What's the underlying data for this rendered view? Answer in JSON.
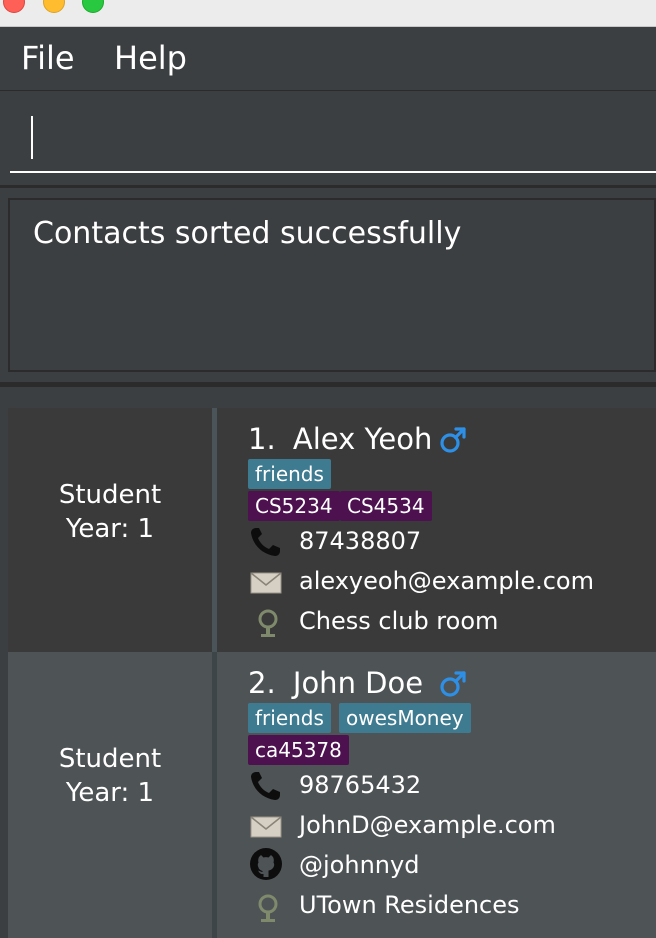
{
  "menu": {
    "file_label": "File",
    "help_label": "Help"
  },
  "command": {
    "value": ""
  },
  "result": {
    "message": "Contacts sorted successfully"
  },
  "contacts": [
    {
      "role": "Student",
      "year": "Year: 1",
      "index": "1.",
      "name": "Alex Yeoh",
      "gender_icon": "male-icon",
      "tags": [
        "friends"
      ],
      "courses": [
        "CS5234",
        "CS4534"
      ],
      "phone": "87438807",
      "email": "alexyeoh@example.com",
      "location": "Chess club room"
    },
    {
      "role": "Student",
      "year": "Year: 1",
      "index": "2.",
      "name": "John Doe",
      "gender_icon": "male-icon",
      "tags": [
        "friends",
        "owesMoney"
      ],
      "courses": [
        "ca45378"
      ],
      "phone": "98765432",
      "email": "JohnD@example.com",
      "github": "@johnnyd",
      "location": "UTown Residences"
    }
  ],
  "colors": {
    "background": "#3c3f41",
    "tag_blue": "#3e7b91",
    "tag_purple": "#4d1150",
    "gender_icon": "#2d8fe6"
  }
}
